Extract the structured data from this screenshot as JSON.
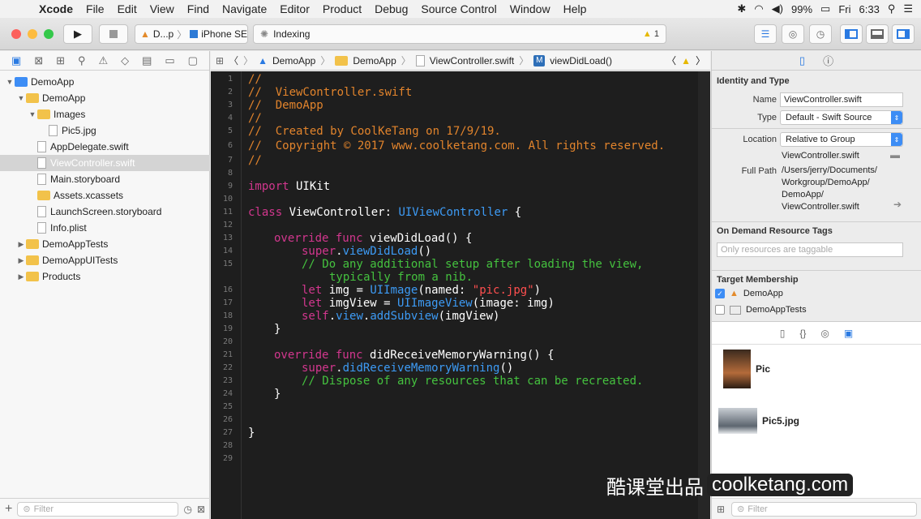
{
  "menubar": {
    "app": "Xcode",
    "items": [
      "File",
      "Edit",
      "View",
      "Find",
      "Navigate",
      "Editor",
      "Product",
      "Debug",
      "Source Control",
      "Window",
      "Help"
    ],
    "battery": "99%",
    "day": "Fri",
    "time": "6:33"
  },
  "toolbar": {
    "scheme": "D...p",
    "device": "iPhone SE",
    "activity": "Indexing",
    "warning_count": "1"
  },
  "navigator": {
    "tree": [
      {
        "label": "DemoApp",
        "depth": 0,
        "kind": "project",
        "expanded": true
      },
      {
        "label": "DemoApp",
        "depth": 1,
        "kind": "folder",
        "expanded": true
      },
      {
        "label": "Images",
        "depth": 2,
        "kind": "folder",
        "expanded": true
      },
      {
        "label": "Pic5.jpg",
        "depth": 3,
        "kind": "file"
      },
      {
        "label": "AppDelegate.swift",
        "depth": 2,
        "kind": "file"
      },
      {
        "label": "ViewController.swift",
        "depth": 2,
        "kind": "file",
        "selected": true
      },
      {
        "label": "Main.storyboard",
        "depth": 2,
        "kind": "file"
      },
      {
        "label": "Assets.xcassets",
        "depth": 2,
        "kind": "folder"
      },
      {
        "label": "LaunchScreen.storyboard",
        "depth": 2,
        "kind": "file"
      },
      {
        "label": "Info.plist",
        "depth": 2,
        "kind": "file"
      },
      {
        "label": "DemoAppTests",
        "depth": 1,
        "kind": "folder",
        "expanded": false
      },
      {
        "label": "DemoAppUITests",
        "depth": 1,
        "kind": "folder",
        "expanded": false
      },
      {
        "label": "Products",
        "depth": 1,
        "kind": "folder",
        "expanded": false
      }
    ],
    "filter_placeholder": "Filter"
  },
  "jumpbar": {
    "crumbs": [
      "DemoApp",
      "DemoApp",
      "ViewController.swift",
      "viewDidLoad()"
    ]
  },
  "editor": {
    "line_numbers": [
      "1",
      "2",
      "3",
      "4",
      "5",
      "6",
      "7",
      "8",
      "9",
      "10",
      "11",
      "12",
      "13",
      "14",
      "15",
      "",
      "16",
      "17",
      "18",
      "19",
      "20",
      "21",
      "22",
      "23",
      "24",
      "25",
      "26",
      "27",
      "28",
      "29"
    ],
    "lines": [
      "//",
      "//  ViewController.swift",
      "//  DemoApp",
      "//",
      "//  Created by CoolKeTang on 17/9/19.",
      "//  Copyright © 2017 www.coolketang.com. All rights reserved.",
      "//",
      "import UIKit",
      "class ViewController: UIViewController {",
      "override func viewDidLoad() {",
      "super.viewDidLoad()",
      "// Do any additional setup after loading the view,",
      "typically from a nib.",
      "let img = UIImage(named: \"pic.jpg\")",
      "let imgView = UIImageView(image: img)",
      "self.view.addSubview(imgView)",
      "}",
      "override func didReceiveMemoryWarning() {",
      "super.didReceiveMemoryWarning()",
      "// Dispose of any resources that can be recreated.",
      "}",
      "}"
    ]
  },
  "inspector": {
    "identity_title": "Identity and Type",
    "name_label": "Name",
    "name_value": "ViewController.swift",
    "type_label": "Type",
    "type_value": "Default - Swift Source",
    "location_label": "Location",
    "location_value": "Relative to Group",
    "location_file": "ViewController.swift",
    "fullpath_label": "Full Path",
    "fullpath_value": "/Users/jerry/Documents/ Workgroup/DemoApp/ DemoApp/ ViewController.swift",
    "fullpath_lines": [
      "/Users/jerry/Documents/",
      "Workgroup/DemoApp/",
      "DemoApp/",
      "ViewController.swift"
    ],
    "odr_title": "On Demand Resource Tags",
    "odr_placeholder": "Only resources are taggable",
    "target_title": "Target Membership",
    "targets": [
      {
        "label": "DemoApp",
        "checked": true
      },
      {
        "label": "DemoAppTests",
        "checked": false
      }
    ]
  },
  "library": {
    "items": [
      "Pic",
      "Pic5.jpg"
    ],
    "filter_placeholder": "Filter"
  },
  "watermark": {
    "cn": "酷课堂出品",
    "site": "coolketang.com"
  }
}
